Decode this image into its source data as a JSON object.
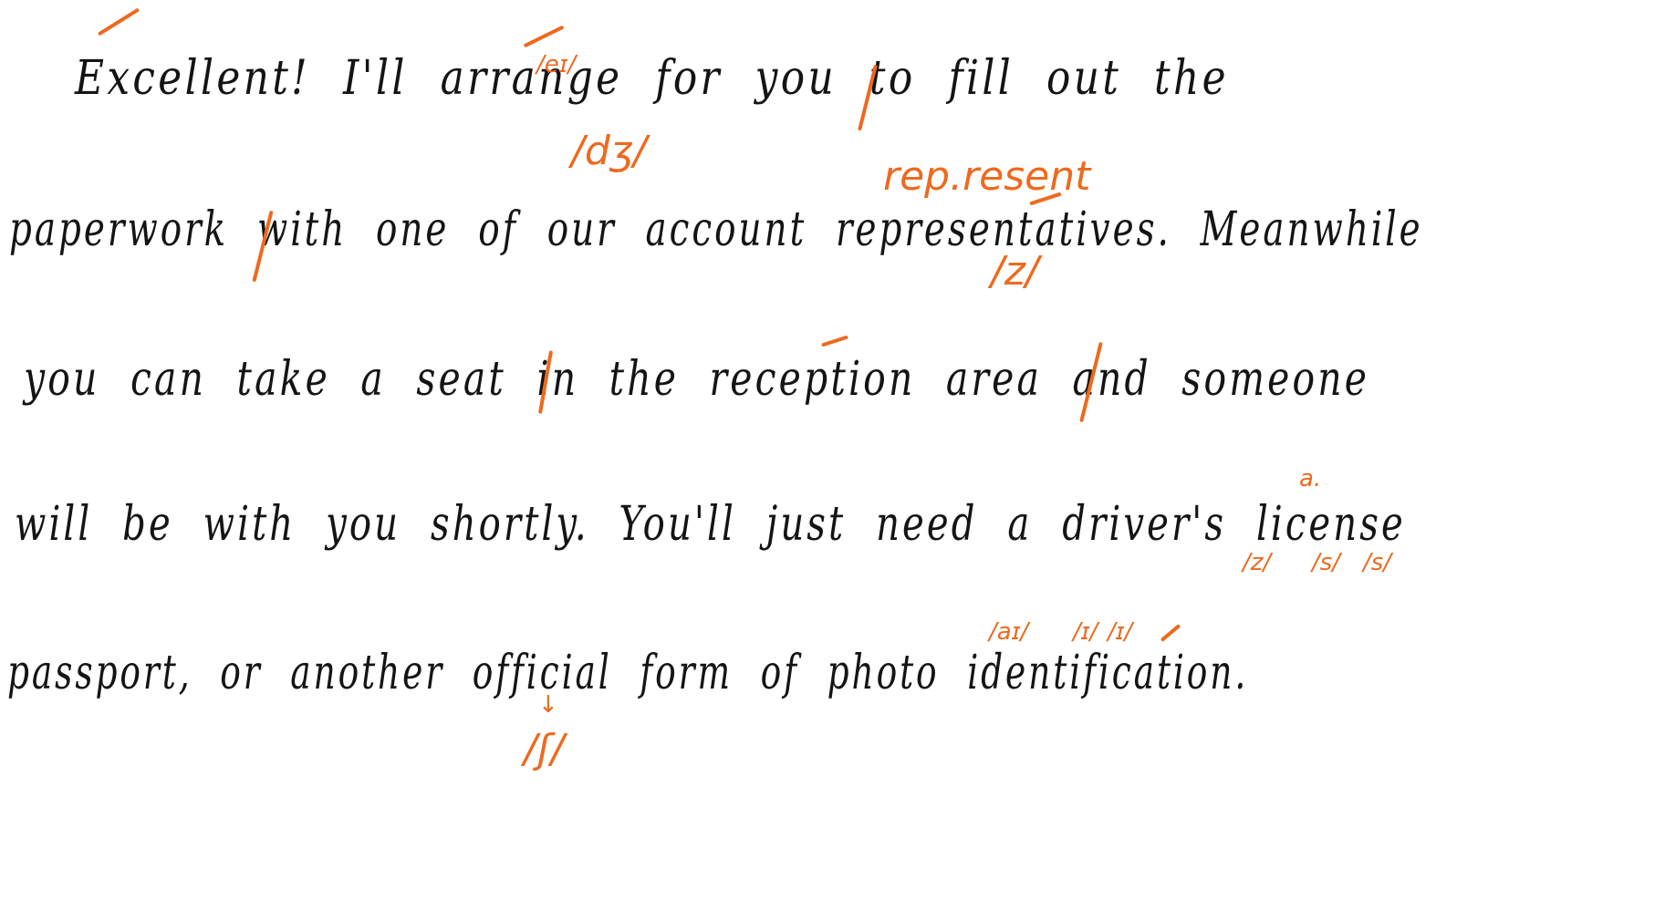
{
  "document": {
    "background": "#ffffff",
    "ink_color": "#141414",
    "annotation_color": "#ed6a1f",
    "lines": [
      "Excellent! I'll arrange for you to fill out the",
      "paperwork with one of our account representatives. Meanwhile",
      "you can take a seat in the reception area and someone",
      "will be with you shortly. You'll just need a driver's license",
      "passport, or another official form of photo identification."
    ],
    "annotations": {
      "arrange_vowel": "/eɪ/",
      "arrange_ending": "/dʒ/",
      "representatives_stem": "rep.resent",
      "representatives_s": "/z/",
      "license_a": "a.",
      "drivers_s": "/z/",
      "license_c": "/s/",
      "license_s": "/s/",
      "identification_i1": "/aɪ/",
      "identification_i2": "/ɪ/",
      "identification_i3": "/ɪ/",
      "official_ci": "/ʃ/",
      "official_arrow": "↓"
    },
    "mark_type": "pause-slash"
  }
}
